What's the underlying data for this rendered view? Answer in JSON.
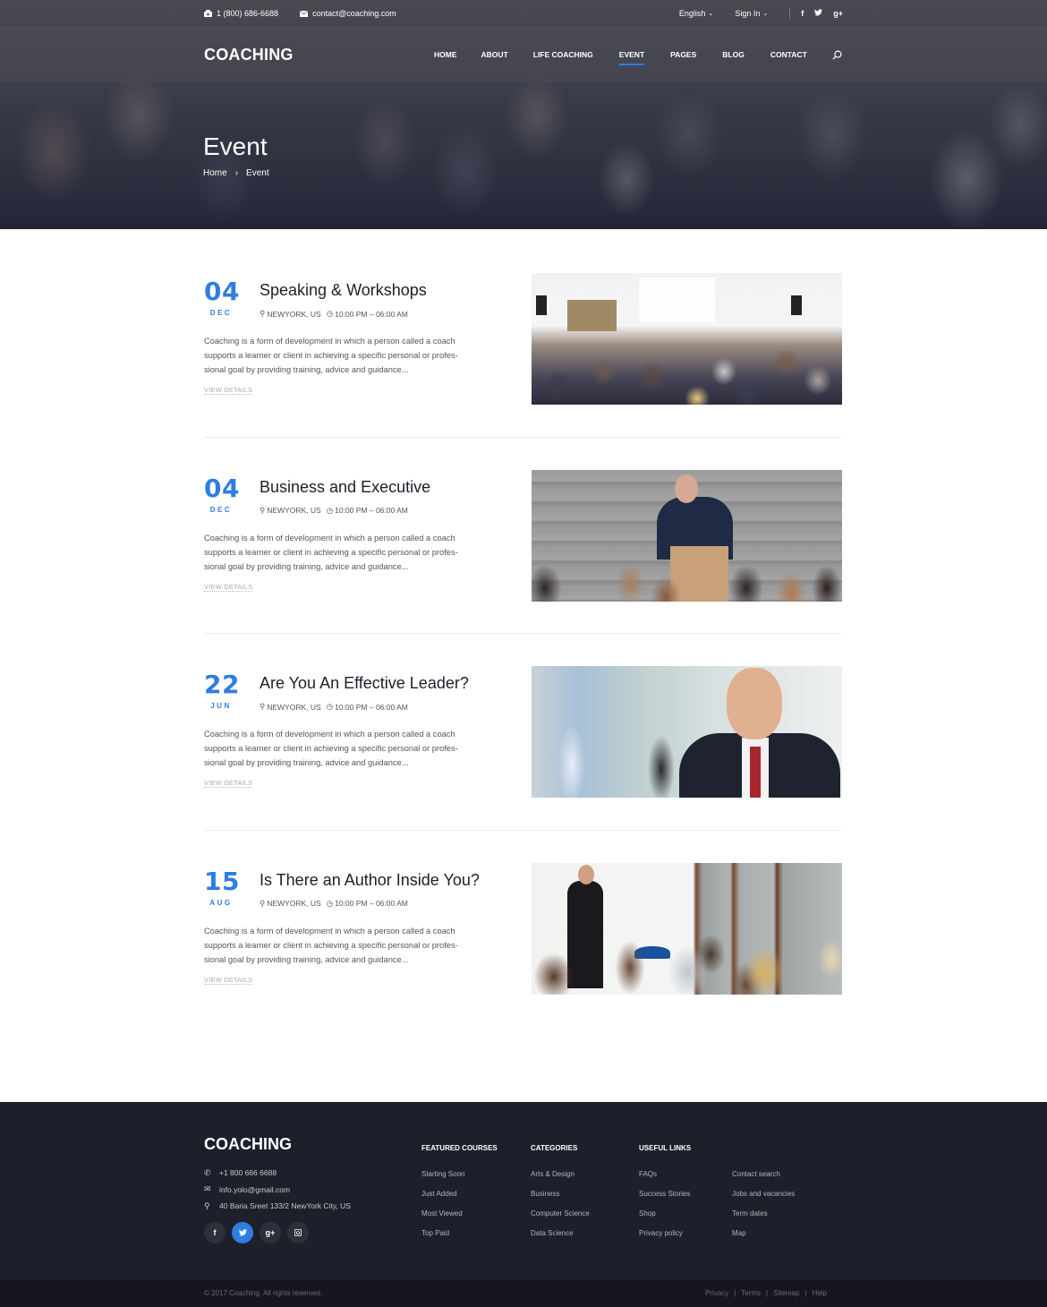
{
  "topbar": {
    "phone": "1 (800) 686-6688",
    "email": "contact@coaching.com",
    "language": "English",
    "signin": "Sign In",
    "social": [
      "facebook-icon",
      "twitter-icon",
      "google-plus-icon"
    ]
  },
  "nav": {
    "logo": "COACHING",
    "items": [
      {
        "label": "HOME"
      },
      {
        "label": "ABOUT"
      },
      {
        "label": "LIFE COACHING"
      },
      {
        "label": "EVENT",
        "active": true
      },
      {
        "label": "PAGES"
      },
      {
        "label": "BLOG"
      },
      {
        "label": "CONTACT"
      }
    ]
  },
  "hero": {
    "title": "Event",
    "breadcrumb": [
      "Home",
      "Event"
    ]
  },
  "events": [
    {
      "day": "04",
      "month": "DEC",
      "title": "Speaking & Workshops",
      "location": "NEWYORK, US",
      "time": "10:00 PM – 06:00 AM",
      "description": "Coaching is a form of development in which a person called a coach supports a learner or client in achieving a specific personal or profes-sional goal by providing training, advice and guidance...",
      "link": "VIEW DETAILS",
      "image": "conference-audience-photo"
    },
    {
      "day": "04",
      "month": "DEC",
      "title": "Business and Executive",
      "location": "NEWYORK, US",
      "time": "10:00 PM – 06:00 AM",
      "description": "Coaching is a form of development in which a person called a coach supports a learner or client in achieving a specific personal or profes-sional goal by providing training, advice and guidance...",
      "link": "VIEW DETAILS",
      "image": "speaker-at-podium-photo"
    },
    {
      "day": "22",
      "month": "JUN",
      "title": "Are You An Effective Leader?",
      "location": "NEWYORK, US",
      "time": "10:00 PM – 06:00 AM",
      "description": "Coaching is a form of development in which a person called a coach supports a learner or client in achieving a specific personal or profes-sional goal by providing training, advice and guidance...",
      "link": "VIEW DETAILS",
      "image": "smiling-businessman-photo"
    },
    {
      "day": "15",
      "month": "AUG",
      "title": "Is There an Author Inside You?",
      "location": "NEWYORK, US",
      "time": "10:00 PM – 06:00 AM",
      "description": "Coaching is a form of development in which a person called a coach supports a learner or client in achieving a specific personal or profes-sional goal by providing training, advice and guidance...",
      "link": "VIEW DETAILS",
      "image": "presenter-classroom-photo"
    }
  ],
  "footer": {
    "logo": "COACHING",
    "phone": "+1 800 666 6688",
    "email": "info.yolo@gmail.com",
    "address": "40 Baria Sreet 133/2 NewYork City, US",
    "social": [
      {
        "icon": "facebook-icon",
        "glyph": "f",
        "active": false
      },
      {
        "icon": "twitter-icon",
        "glyph": "t",
        "active": true
      },
      {
        "icon": "google-plus-icon",
        "glyph": "g+",
        "active": false
      },
      {
        "icon": "instagram-icon",
        "glyph": "◙",
        "active": false
      }
    ],
    "columns": [
      {
        "title": "FEATURED COURSES",
        "links": [
          "Starting Soon",
          "Just Added",
          "Most Viewed",
          "Top Paid"
        ]
      },
      {
        "title": "CATEGORIES",
        "links": [
          "Arts & Design",
          "Business",
          "Computer Science",
          "Data Science"
        ]
      },
      {
        "title": "USEFUL LINKS",
        "links": [
          "FAQs",
          "Success Stories",
          "Shop",
          "Privacy policy"
        ]
      },
      {
        "title": "",
        "links": [
          "Contact search",
          "Jobs and vacancies",
          "Term dates",
          "Map"
        ]
      }
    ],
    "copyright": "© 2017 Coaching. All rights reserved.",
    "bottom_links": [
      "Privacy",
      "Terms",
      "Sitemap",
      "Help"
    ]
  },
  "colors": {
    "accent": "#2f7de1",
    "footer_bg": "#1d1f2b",
    "bottombar_bg": "#15161f",
    "title_text": "#1e1e2a"
  }
}
